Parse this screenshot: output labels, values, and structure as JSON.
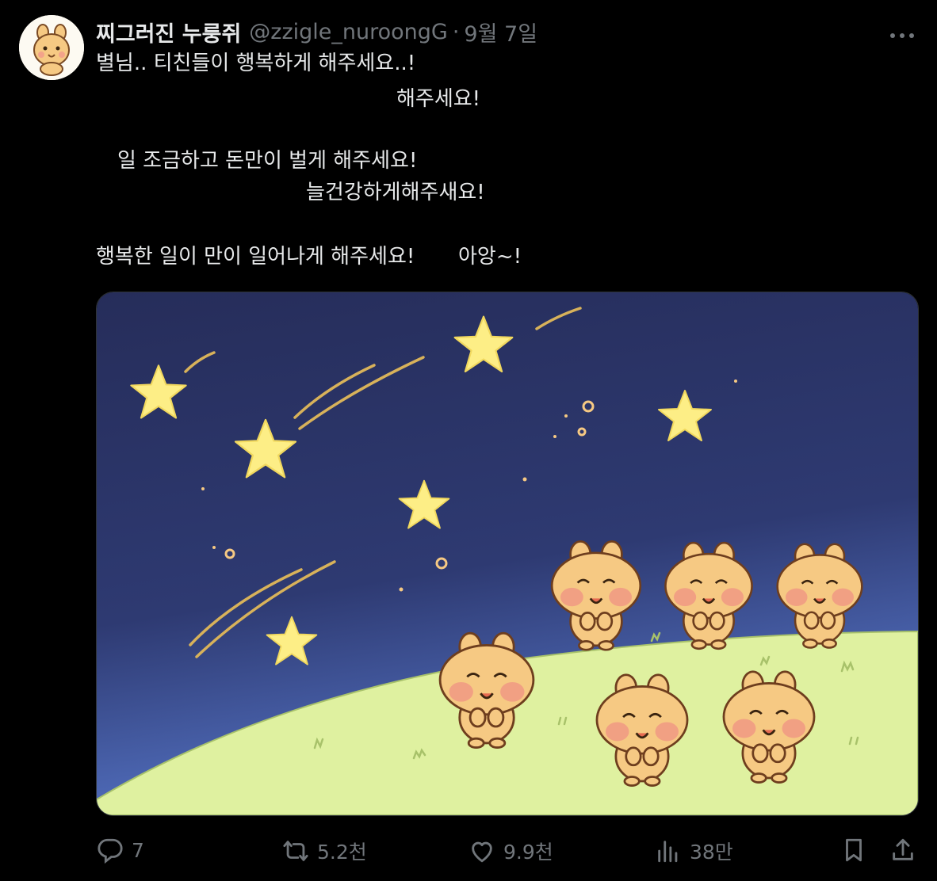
{
  "tweet": {
    "display_name": "찌그러진 누룽쥐",
    "handle": "@zzigle_nuroongG",
    "separator": "·",
    "date": "9월 7일",
    "lines": [
      "별님.. 티친들이 행복하게 해주세요..!",
      "해주세요!",
      "일 조금하고 돈만이 벌게 해주세요!",
      "늘건강하게해주새요!",
      "행복한 일이 만이 일어나게 해주세요!",
      "아앙~!"
    ]
  },
  "actions": {
    "reply_count": "7",
    "retweet_count": "5.2천",
    "like_count": "9.9천",
    "view_count": "38만"
  },
  "icons": [
    "more-icon",
    "reply-icon",
    "retweet-icon",
    "like-icon",
    "views-icon",
    "bookmark-icon",
    "share-icon"
  ],
  "colors": {
    "background": "#000000",
    "text": "#e7e9ea",
    "muted": "#71767b",
    "sky_top": "#28305e",
    "sky_bottom": "#4a64b5",
    "star": "#fdee86",
    "grass": "#dff1a0",
    "character": "#f6c983"
  }
}
